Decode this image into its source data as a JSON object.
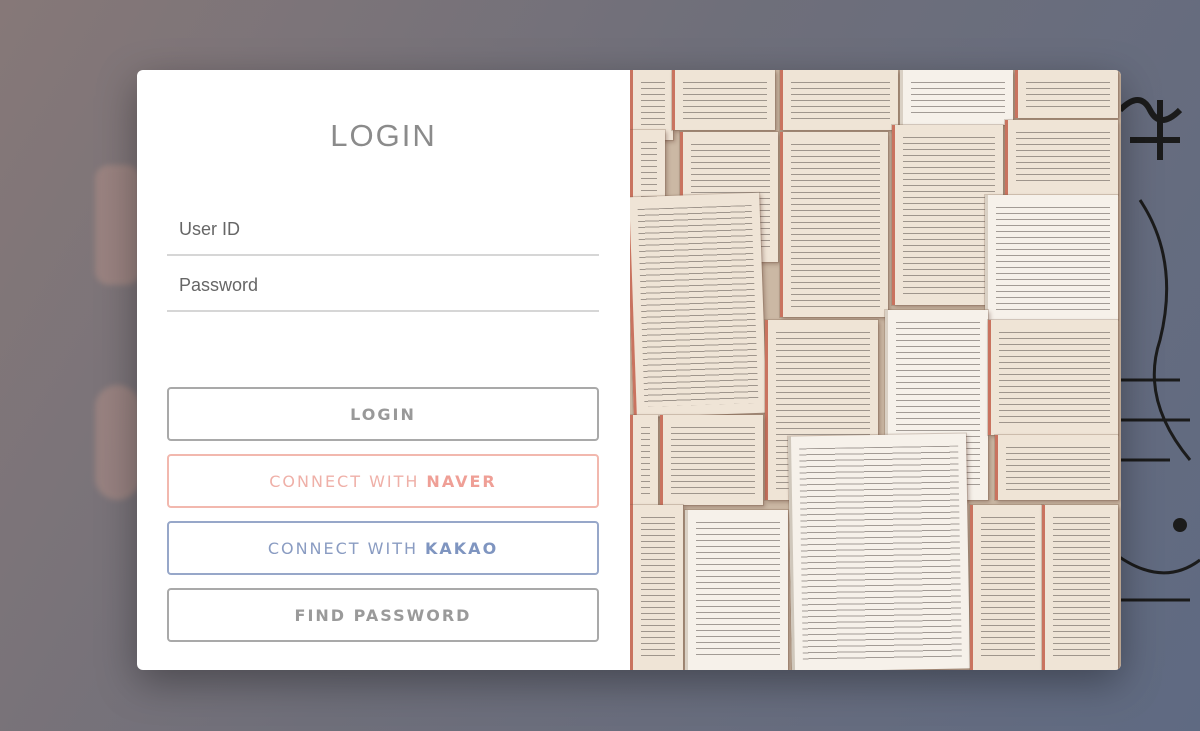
{
  "login_form": {
    "title": "LOGIN",
    "user_id_placeholder": "User ID",
    "password_placeholder": "Password"
  },
  "buttons": {
    "login": "LOGIN",
    "naver_prefix": "CONNECT WITH",
    "naver_brand": "NAVER",
    "kakao_prefix": "CONNECT WITH",
    "kakao_brand": "KAKAO",
    "find_password": "FIND PASSWORD"
  },
  "colors": {
    "naver_accent": "#efb0a8",
    "kakao_accent": "#8a9cc2",
    "neutral_border": "#a9a9a9"
  },
  "side_image": {
    "icon": "open-books-photo"
  }
}
